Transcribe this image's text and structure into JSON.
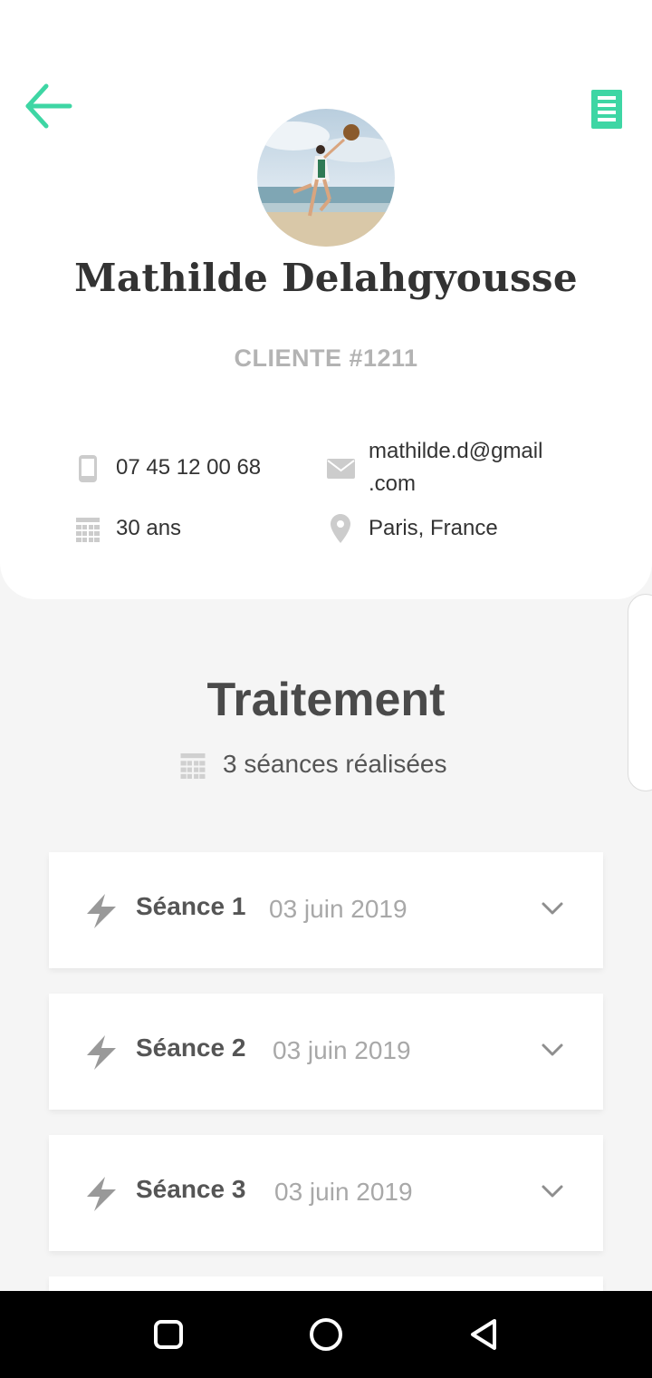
{
  "header": {
    "back_icon": "arrow-left-icon",
    "menu_icon": "document-list-icon",
    "accent_color": "#3ed6a4"
  },
  "client": {
    "name": "Mathilde Delahgyousse",
    "id_label": "CLIENTE #1211",
    "phone": "07 45 12 00 68",
    "email_line1": "mathilde.d@gmail",
    "email_line2": ".com",
    "age": "30 ans",
    "location": "Paris, France"
  },
  "treatment": {
    "title": "Traitement",
    "sessions_count": "3 séances réalisées",
    "sessions": [
      {
        "label": "Séance 1",
        "date": "03 juin 2019"
      },
      {
        "label": "Séance 2",
        "date": "03 juin 2019"
      },
      {
        "label": "Séance 3",
        "date": "03 juin 2019"
      }
    ]
  },
  "navbar": {
    "recents_icon": "square-icon",
    "home_icon": "circle-icon",
    "back_icon": "triangle-back-icon"
  }
}
